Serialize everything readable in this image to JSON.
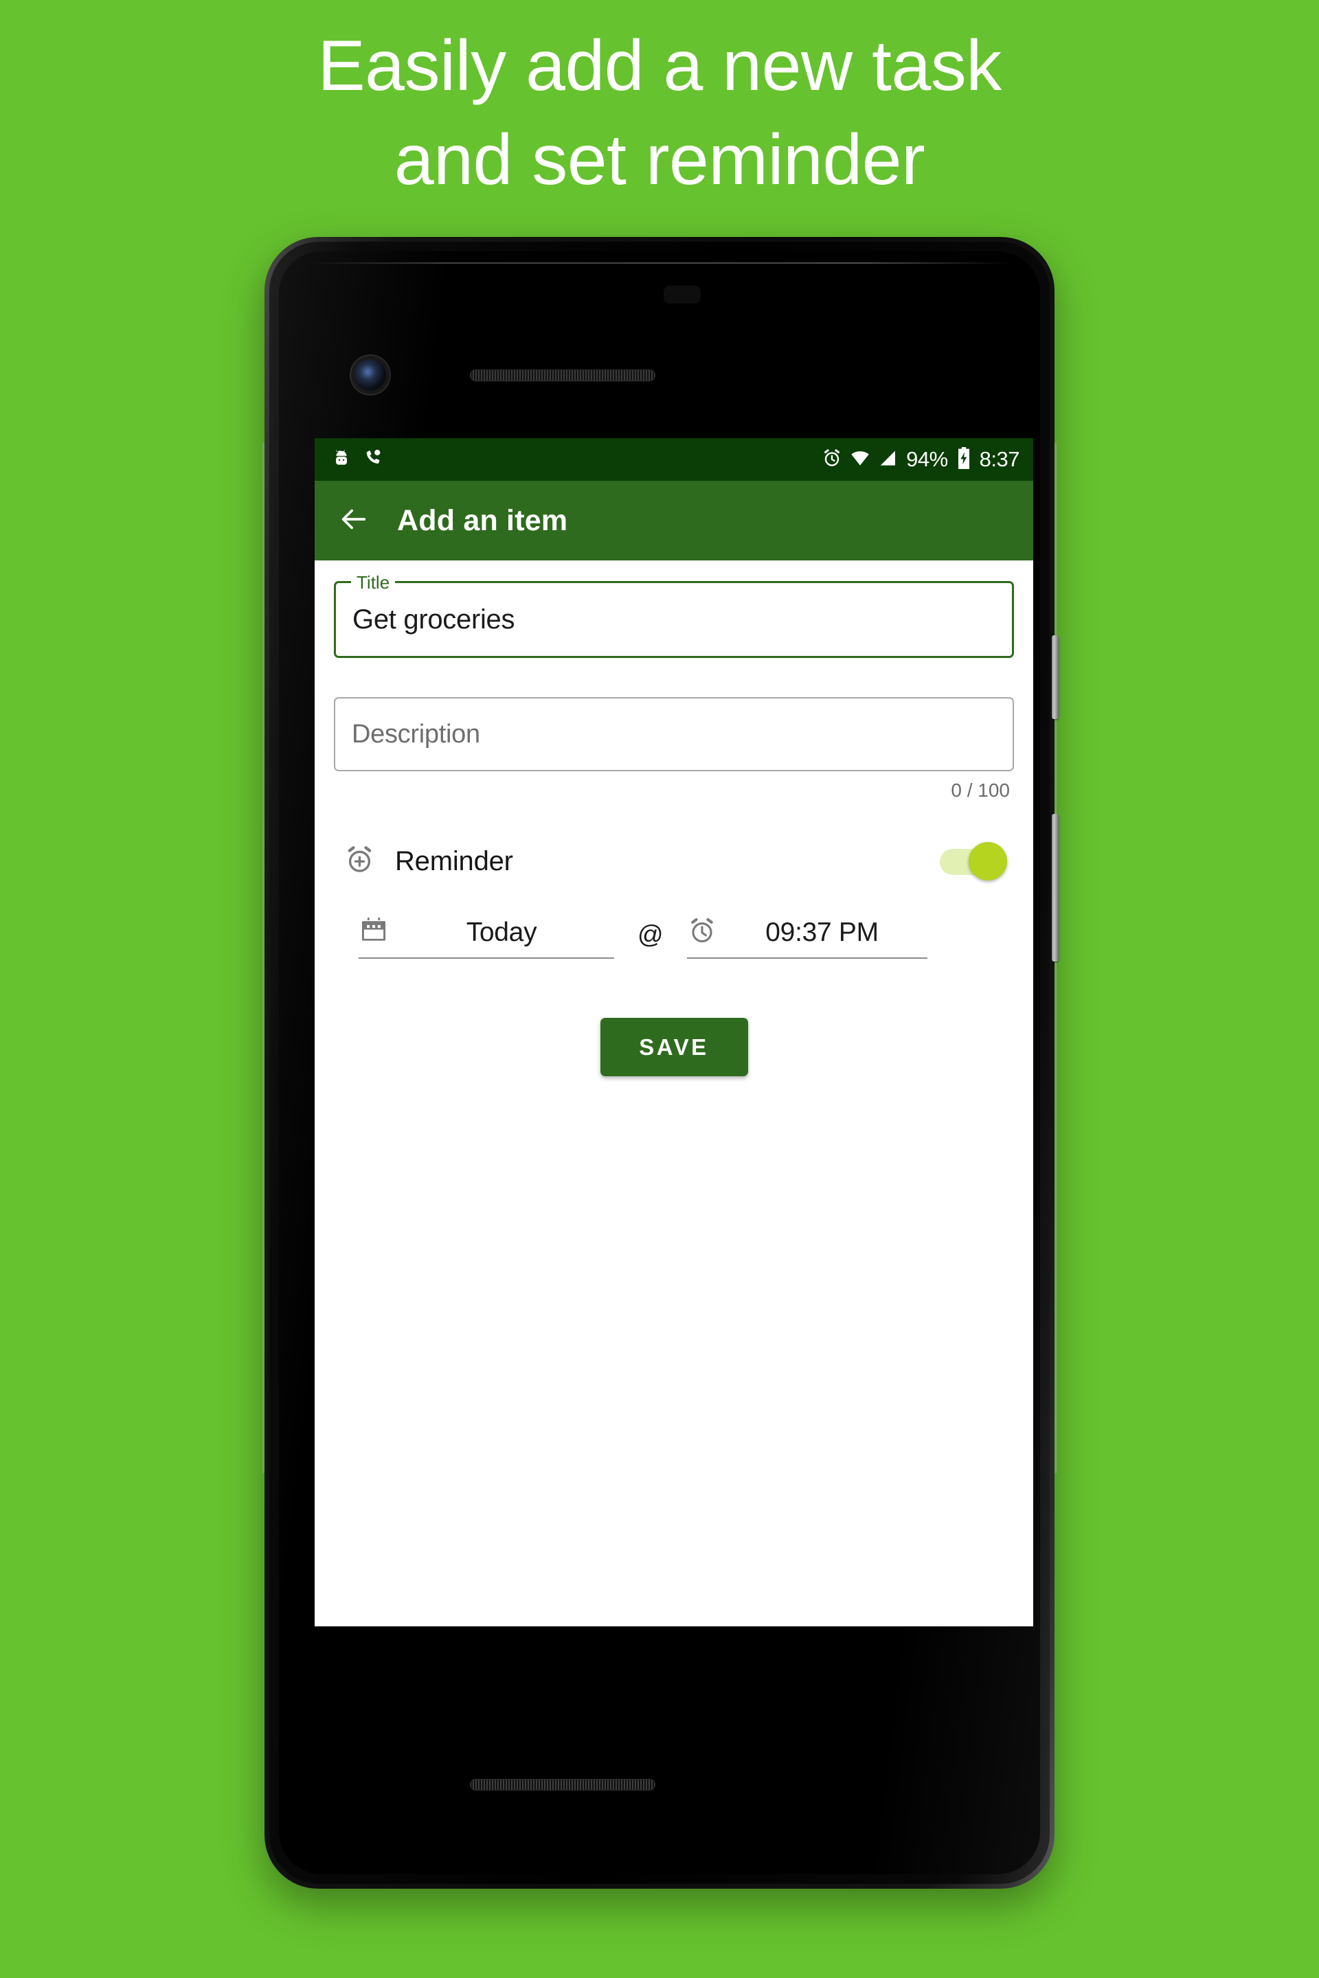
{
  "promo": {
    "headline": "Easily add a new task\nand set reminder",
    "background_color": "#66c22e",
    "headline_color": "#ffffff"
  },
  "device": {
    "body_color": "#101010",
    "icons": {
      "front_camera": "camera-icon",
      "earpiece": "speaker-grille",
      "bottom_speaker": "speaker-grille",
      "power_button": "power-button",
      "volume_button": "volume-button"
    }
  },
  "statusbar": {
    "background_color": "#0b3d06",
    "left_icons": [
      "android-icon",
      "missed-call-icon"
    ],
    "right_icons": [
      "alarm-icon",
      "wifi-icon",
      "cellular-signal-icon",
      "battery-charging-icon"
    ],
    "battery_percent": "94%",
    "clock": "8:37"
  },
  "appbar": {
    "background_color": "#2f6b1e",
    "back_icon": "back-arrow-icon",
    "title": "Add an item"
  },
  "form": {
    "title_field": {
      "label": "Title",
      "value": "Get groceries",
      "border_color": "#2f6b1e"
    },
    "description_field": {
      "placeholder": "Description",
      "value": "",
      "counter": "0 / 100",
      "border_color": "#a8a8a8"
    },
    "reminder": {
      "icon": "alarm-add-icon",
      "label": "Reminder",
      "enabled": true,
      "thumb_color": "#b4d420",
      "track_color": "#e2f0b4"
    },
    "schedule": {
      "date_icon": "calendar-icon",
      "date_value": "Today",
      "separator": "@",
      "time_icon": "alarm-clock-icon",
      "time_value": "09:37 PM"
    },
    "save_button": {
      "label": "SAVE",
      "color": "#2f6b1e"
    }
  }
}
